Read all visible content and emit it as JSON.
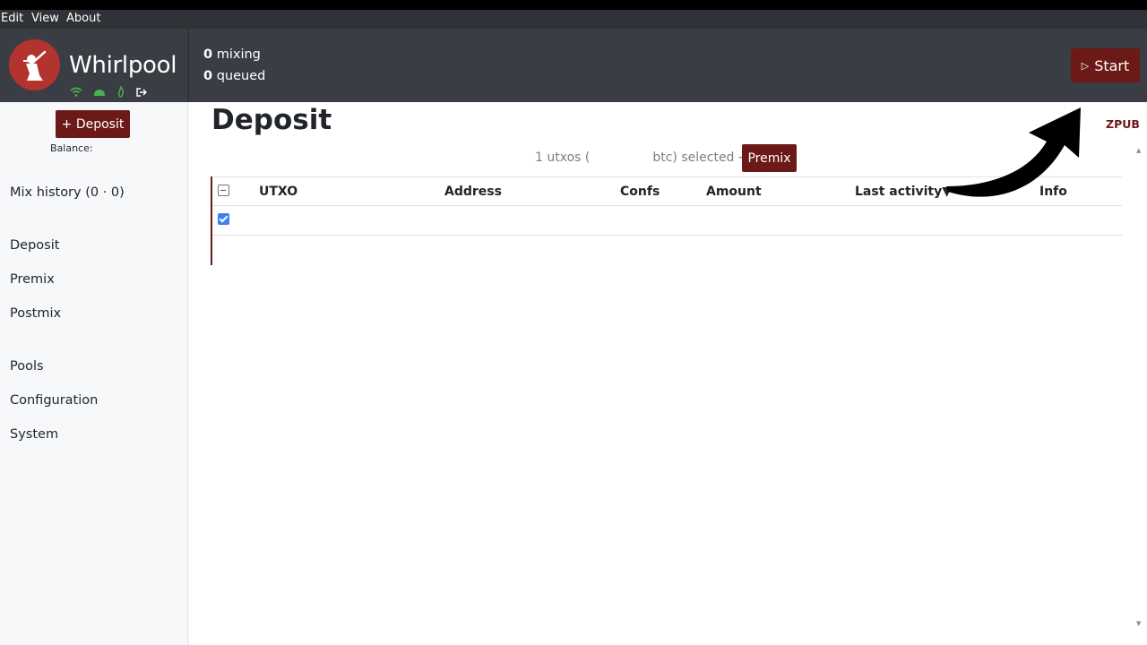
{
  "menubar": {
    "items": [
      "Edit",
      "View",
      "About"
    ]
  },
  "header": {
    "brand": "Whirlpool",
    "mixing_count": "0",
    "mixing_label": "mixing",
    "queued_count": "0",
    "queued_label": "queued",
    "start_label": "Start",
    "status_icons": [
      "wifi-icon",
      "android-icon",
      "tor-icon",
      "logout-icon"
    ]
  },
  "sidebar": {
    "deposit_label": "+ Deposit",
    "balance_label": "Balance:",
    "mix_history": "Mix history (0 · 0)",
    "nav": [
      "Deposit",
      "Premix",
      "Postmix"
    ],
    "nav2": [
      "Pools",
      "Configuration",
      "System"
    ]
  },
  "main": {
    "title": "Deposit",
    "zpub": "ZPUB",
    "selection_prefix": "1 utxos (",
    "selection_suffix": "btc) selected →",
    "premix_label": "Premix",
    "columns": [
      "UTXO",
      "Address",
      "Confs",
      "Amount",
      "Last activity▼",
      "Info"
    ]
  },
  "colors": {
    "accent": "#6b1a18",
    "header_bg": "#3a3e44",
    "logo_red": "#b3332e",
    "status_green": "#4caf50"
  }
}
